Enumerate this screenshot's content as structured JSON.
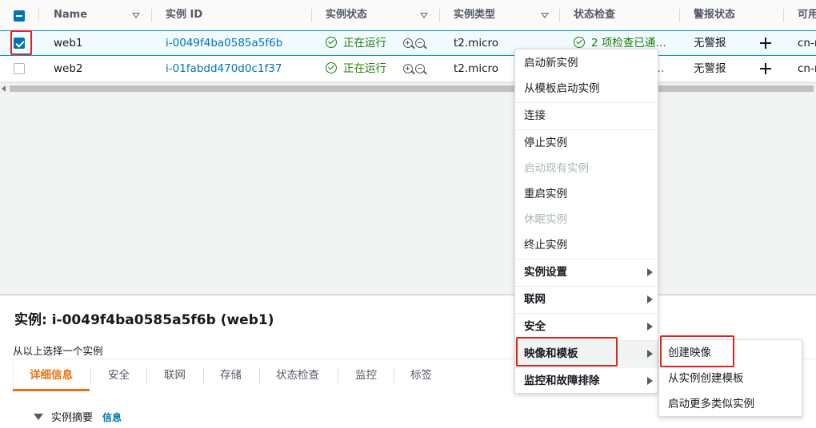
{
  "table": {
    "columns": [
      {
        "label": "Name"
      },
      {
        "label": "实例 ID"
      },
      {
        "label": "实例状态"
      },
      {
        "label": "实例类型"
      },
      {
        "label": "状态检查"
      },
      {
        "label": "警报状态"
      },
      {
        "label": "可用"
      }
    ],
    "rows": [
      {
        "name": "web1",
        "instance_id": "i-0049f4ba0585a5f6b",
        "state": "正在运行",
        "type": "t2.micro",
        "status_check": "2 项检查已通…",
        "alarm": "无警报",
        "az": "cn-n",
        "selected": true
      },
      {
        "name": "web2",
        "instance_id": "i-01fabdd470d0c1f37",
        "state": "正在运行",
        "type": "t2.micro",
        "status_check": "…",
        "alarm": "无警报",
        "az": "cn-n",
        "selected": false
      }
    ]
  },
  "detail": {
    "title": "实例: i-0049f4ba0585a5f6b (web1)",
    "subtitle": "从以上选择一个实例",
    "tabs": [
      "详细信息",
      "安全",
      "联网",
      "存储",
      "状态检查",
      "监控",
      "标签"
    ],
    "active_tab": "详细信息",
    "section_label": "实例摘要",
    "section_info": "信息"
  },
  "context_menu": {
    "items": [
      {
        "label": "启动新实例",
        "enabled": true
      },
      {
        "label": "从模板启动实例",
        "enabled": true
      },
      {
        "label": "连接",
        "enabled": true
      },
      {
        "label": "停止实例",
        "enabled": true
      },
      {
        "label": "启动现有实例",
        "enabled": false
      },
      {
        "label": "重启实例",
        "enabled": true
      },
      {
        "label": "休眠实例",
        "enabled": false
      },
      {
        "label": "终止实例",
        "enabled": true
      },
      {
        "label": "实例设置",
        "enabled": true,
        "submenu": true
      },
      {
        "label": "联网",
        "enabled": true,
        "submenu": true
      },
      {
        "label": "安全",
        "enabled": true,
        "submenu": true
      },
      {
        "label": "映像和模板",
        "enabled": true,
        "submenu": true,
        "highlighted": true
      },
      {
        "label": "监控和故障排除",
        "enabled": true,
        "submenu": true
      }
    ]
  },
  "submenu": {
    "items": [
      {
        "label": "创建映像"
      },
      {
        "label": "从实例创建模板"
      },
      {
        "label": "启动更多类似实例"
      }
    ]
  },
  "colors": {
    "link": "#0073bb",
    "running": "#1d8102",
    "accent_tab": "#ec7211",
    "annotation_red": "#e0231d",
    "checkbox_blue": "#0073bb"
  }
}
